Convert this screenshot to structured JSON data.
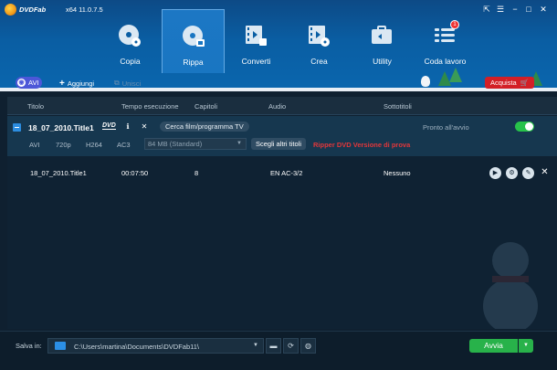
{
  "app": {
    "brand": "DVDFab",
    "version": "x64  11.0.7.5"
  },
  "modules": [
    {
      "label": "Copia",
      "icon": "disc-copy-icon"
    },
    {
      "label": "Ripp a",
      "icon": "disc-rip-icon"
    },
    {
      "label": "Converti",
      "icon": "film-convert-icon"
    },
    {
      "label": "Crea",
      "icon": "film-create-icon"
    },
    {
      "label": "Utility",
      "icon": "toolbox-icon"
    },
    {
      "label": "Coda lavoro",
      "icon": "queue-icon",
      "badge": "1"
    }
  ],
  "toolbar": {
    "avi": "AVI",
    "add": "Aggiungi",
    "merge": "Unisci",
    "buy": "Acquista"
  },
  "columns": [
    "Titolo",
    "Tempo esecuzione",
    "Capitoli",
    "Audio",
    "Sottotitoli"
  ],
  "group": {
    "title": "18_07_2010.Title1",
    "dvd_logo": "DVD",
    "search_btn": "Cerca film/programma TV",
    "status": "Pronto all'avvio",
    "format": "AVI",
    "resolution": "720p",
    "codec": "H264",
    "audio_codec": "AC3",
    "size_option": "84 MB (Standard)",
    "choose_titles": "Scegli altri titoli",
    "trial_note": "Ripper DVD  Versione di prova"
  },
  "rows": [
    {
      "title": "18_07_2010.Title1",
      "duration": "00:07:50",
      "chapters": "8",
      "audio": "EN  AC-3/2",
      "subtitles": "Nessuno"
    }
  ],
  "footer": {
    "save_label": "Salva in:",
    "path": "C:\\Users\\martina\\Documents\\DVDFab11\\",
    "start": "Avvia"
  },
  "colors": {
    "accent": "#0a66ae",
    "start": "#28b24a",
    "buy": "#d31f26",
    "toggle_on": "#27c24a"
  }
}
